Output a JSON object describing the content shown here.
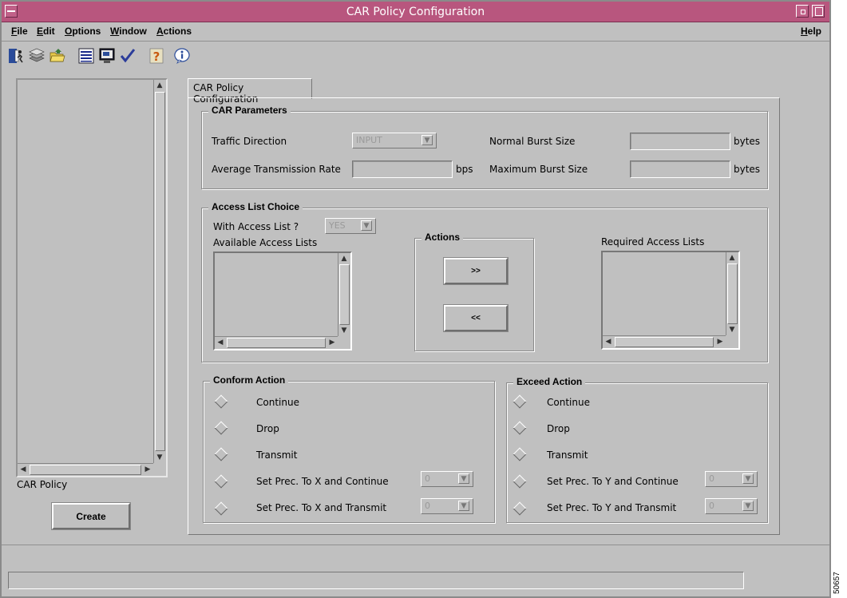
{
  "window": {
    "title": "CAR Policy Configuration"
  },
  "menubar": {
    "items": [
      "File",
      "Edit",
      "Options",
      "Window",
      "Actions"
    ],
    "help": "Help"
  },
  "toolbar": {
    "icons": [
      "exit-icon",
      "policy-stack-icon",
      "open-folder-icon",
      "list-view-icon",
      "monitor-icon",
      "checkmark-icon",
      "help-question-icon",
      "info-icon"
    ]
  },
  "left_panel": {
    "list_label": "CAR Policy",
    "create_label": "Create"
  },
  "tab": {
    "label": "CAR Policy Configuration"
  },
  "car_parameters": {
    "title": "CAR Parameters",
    "traffic_direction_label": "Traffic Direction",
    "traffic_direction_value": "INPUT",
    "avg_rate_label": "Average Transmission Rate",
    "avg_rate_unit": "bps",
    "avg_rate_value": "",
    "normal_burst_label": "Normal Burst Size",
    "normal_burst_unit": "bytes",
    "normal_burst_value": "",
    "max_burst_label": "Maximum Burst Size",
    "max_burst_unit": "bytes",
    "max_burst_value": ""
  },
  "access_list": {
    "title": "Access List Choice",
    "with_access_label": "With Access List ?",
    "with_access_value": "YES",
    "available_label": "Available Access Lists",
    "required_label": "Required Access Lists",
    "actions_title": "Actions",
    "add_label": ">>",
    "remove_label": "<<"
  },
  "conform_action": {
    "title": "Conform Action",
    "options": [
      "Continue",
      "Drop",
      "Transmit",
      "Set Prec. To X and Continue",
      "Set Prec. To X and Transmit"
    ],
    "prec_continue_value": "0",
    "prec_transmit_value": "0"
  },
  "exceed_action": {
    "title": "Exceed Action",
    "options": [
      "Continue",
      "Drop",
      "Transmit",
      "Set Prec. To Y and Continue",
      "Set Prec. To Y and Transmit"
    ],
    "prec_continue_value": "0",
    "prec_transmit_value": "0"
  },
  "figure_id": "50657"
}
